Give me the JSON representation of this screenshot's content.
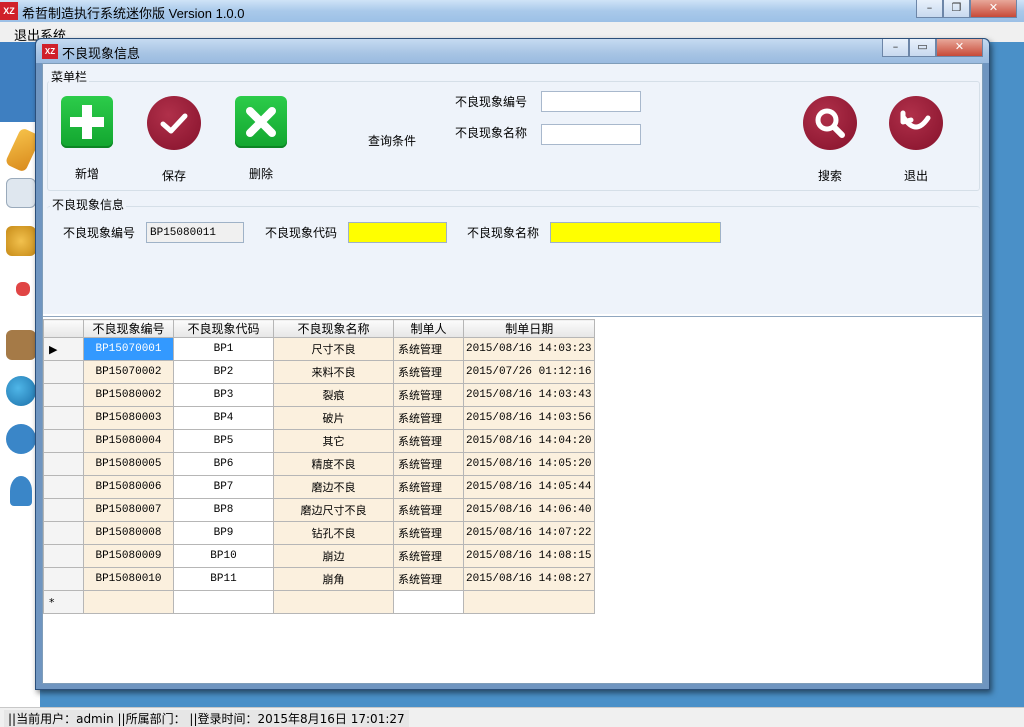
{
  "app": {
    "title": "希哲制造执行系统迷你版 Version 1.0.0",
    "icon_text": "XZ",
    "menu": {
      "exit": "退出系统"
    }
  },
  "dialog": {
    "title": "不良现象信息",
    "icon_text": "XZ",
    "menu_group": "菜单栏",
    "info_group": "不良现象信息"
  },
  "toolbar": {
    "add": "新增",
    "save": "保存",
    "delete": "删除",
    "search": "搜索",
    "exit": "退出"
  },
  "query": {
    "label": "查询条件",
    "code_label": "不良现象编号",
    "code_value": "",
    "name_label": "不良现象名称",
    "name_value": ""
  },
  "info": {
    "no_label": "不良现象编号",
    "no_value": "BP15080011",
    "code_label": "不良现象代码",
    "code_value": "",
    "name_label": "不良现象名称",
    "name_value": "",
    "highlight_color": "#ffff00"
  },
  "grid": {
    "columns": [
      "不良现象编号",
      "不良现象代码",
      "不良现象名称",
      "制单人",
      "制单日期"
    ],
    "selected_indicator": "▶",
    "new_row_indicator": "*",
    "rows": [
      [
        "BP15070001",
        "BP1",
        "尺寸不良",
        "系统管理",
        "2015/08/16 14:03:23"
      ],
      [
        "BP15070002",
        "BP2",
        "来料不良",
        "系统管理",
        "2015/07/26 01:12:16"
      ],
      [
        "BP15080002",
        "BP3",
        "裂痕",
        "系统管理",
        "2015/08/16 14:03:43"
      ],
      [
        "BP15080003",
        "BP4",
        "破片",
        "系统管理",
        "2015/08/16 14:03:56"
      ],
      [
        "BP15080004",
        "BP5",
        "其它",
        "系统管理",
        "2015/08/16 14:04:20"
      ],
      [
        "BP15080005",
        "BP6",
        "精度不良",
        "系统管理",
        "2015/08/16 14:05:20"
      ],
      [
        "BP15080006",
        "BP7",
        "磨边不良",
        "系统管理",
        "2015/08/16 14:05:44"
      ],
      [
        "BP15080007",
        "BP8",
        "磨边尺寸不良",
        "系统管理",
        "2015/08/16 14:06:40"
      ],
      [
        "BP15080008",
        "BP9",
        "钻孔不良",
        "系统管理",
        "2015/08/16 14:07:22"
      ],
      [
        "BP15080009",
        "BP10",
        "崩边",
        "系统管理",
        "2015/08/16 14:08:15"
      ],
      [
        "BP15080010",
        "BP11",
        "崩角",
        "系统管理",
        "2015/08/16 14:08:27"
      ]
    ]
  },
  "status": {
    "text": "||当前用户：admin  ||所属部门：  ||登录时间：2015年8月16日 17:01:27"
  },
  "colors": {
    "accent_green": "#18b23a",
    "accent_red": "#8f1530",
    "selection": "#3399ff"
  }
}
